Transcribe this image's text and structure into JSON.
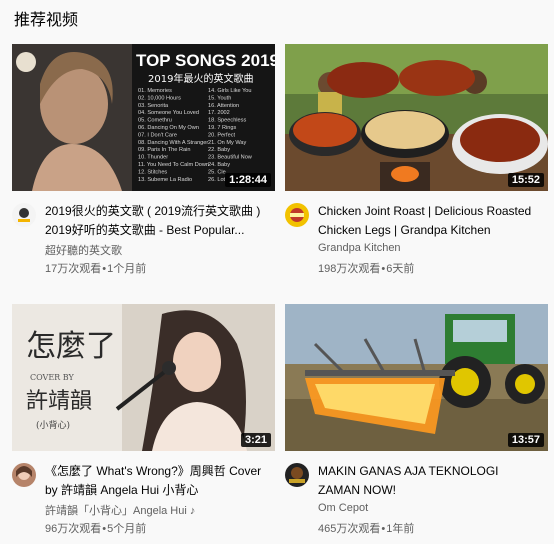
{
  "section": {
    "title": "推荐视频"
  },
  "videos": [
    {
      "duration": "1:28:44",
      "title_line1": "2019很火的英文歌 ( 2019流行英文歌曲 )",
      "title_line2": "2019好听的英文歌曲 - Best Popular...",
      "channel": "超好聽的英文歌",
      "views": "17万次观看",
      "age": "1个月前",
      "thumb_text": {
        "headline": "TOP SONGS 2019",
        "sub": "2019年最火的英文歌曲",
        "tracks_left": [
          "01. Memories",
          "02. 10,000 Hours",
          "03. Senorita",
          "04. Someone You Loved",
          "05. Comethru",
          "06. Dancing On My Own",
          "07. I Don't Care",
          "08. Dancing With A Stranger",
          "09. Paris In The Rain",
          "10. Thunder",
          "11. You Need To Calm Down",
          "12. Stitches",
          "13. Subeme La Radio"
        ],
        "tracks_right": [
          "14. Girls Like You",
          "15. Youth",
          "16. Attention",
          "17. 2002",
          "18. Speechless",
          "19. 7 Rings",
          "20. Perfect",
          "21. On My Way",
          "22. Baby",
          "23. Beautiful Now",
          "24. Baby",
          "25. Cle",
          "26. Lot"
        ]
      }
    },
    {
      "duration": "15:52",
      "title_line1": "Chicken Joint Roast | Delicious Roasted",
      "title_line2": "Chicken Legs | Grandpa Kitchen",
      "channel": "Grandpa Kitchen",
      "views": "198万次观看",
      "age": "6天前"
    },
    {
      "duration": "3:21",
      "title_line1": "《怎麼了 What's Wrong?》周興哲 Cover",
      "title_line2": "by 許靖韻 Angela Hui 小背心",
      "channel": "許靖韻「小背心」Angela Hui ♪",
      "views": "96万次观看",
      "age": "5个月前",
      "thumb_text": {
        "big": "怎麼了",
        "cover": "COVER BY",
        "name": "許靖韻",
        "nick": "(小背心)"
      }
    },
    {
      "duration": "13:57",
      "title_line1": "MAKIN GANAS AJA TEKNOLOGI",
      "title_line2": "ZAMAN NOW!",
      "channel": "Om Cepot",
      "views": "465万次观看",
      "age": "1年前"
    }
  ],
  "separator": "•"
}
